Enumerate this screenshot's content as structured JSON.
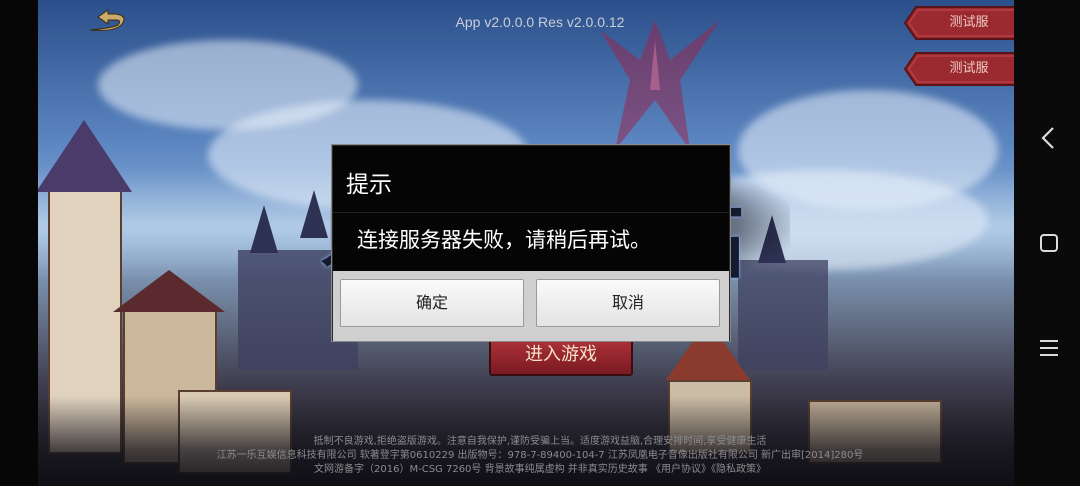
{
  "header": {
    "version": "App v2.0.0.0 Res v2.0.0.12"
  },
  "server_buttons": [
    {
      "label": "测试服"
    },
    {
      "label": "测试服"
    }
  ],
  "enter_button": {
    "label": "进入游戏"
  },
  "dialog": {
    "title": "提示",
    "message": "连接服务器失败，请稍后再试。",
    "confirm_label": "确定",
    "cancel_label": "取消"
  },
  "footer": {
    "line1": "抵制不良游戏,拒绝盗版游戏。注意自我保护,谨防受骗上当。适度游戏益脑,合理安排时间,享受健康生活",
    "line2": "江苏一乐互娱信息科技有限公司   软著登字第0610229  出版物号：978-7-89400-104-7  江苏凤凰电子音像出版社有限公司  新广出审[2014]280号",
    "line3": "文网游备字（2016）M-CSG 7260号  背景故事纯属虚构  并非真实历史故事  《用户协议》《隐私政策》"
  },
  "nav": {
    "icons": [
      "back-icon",
      "home-icon",
      "menu-icon"
    ]
  },
  "colors": {
    "accent": "#a8262f",
    "dialog_bg": "#050505",
    "button_bg": "#f0f0f0"
  }
}
